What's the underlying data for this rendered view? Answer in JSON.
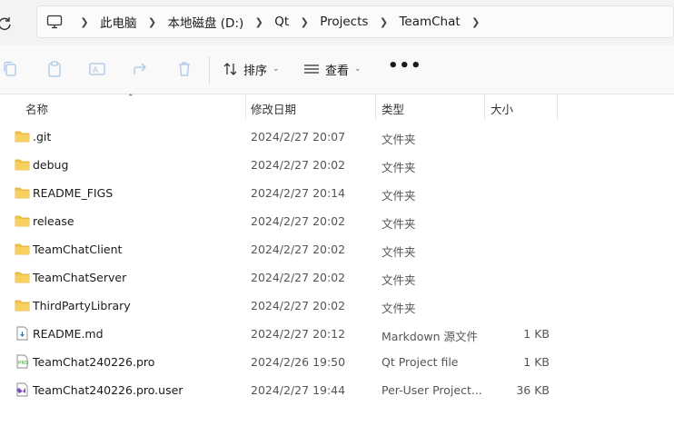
{
  "breadcrumb": [
    "此电脑",
    "本地磁盘 (D:)",
    "Qt",
    "Projects",
    "TeamChat"
  ],
  "toolbar": {
    "sort_label": "排序",
    "view_label": "查看",
    "more_label": "•••"
  },
  "columns": {
    "name": "名称",
    "date": "修改日期",
    "type": "类型",
    "size": "大小"
  },
  "files": [
    {
      "name": ".git",
      "date": "2024/2/27 20:07",
      "type": "文件夹",
      "size": "",
      "icon": "folder-icon"
    },
    {
      "name": "debug",
      "date": "2024/2/27 20:02",
      "type": "文件夹",
      "size": "",
      "icon": "folder-icon"
    },
    {
      "name": "README_FIGS",
      "date": "2024/2/27 20:14",
      "type": "文件夹",
      "size": "",
      "icon": "folder-icon"
    },
    {
      "name": "release",
      "date": "2024/2/27 20:02",
      "type": "文件夹",
      "size": "",
      "icon": "folder-icon"
    },
    {
      "name": "TeamChatClient",
      "date": "2024/2/27 20:02",
      "type": "文件夹",
      "size": "",
      "icon": "folder-icon"
    },
    {
      "name": "TeamChatServer",
      "date": "2024/2/27 20:02",
      "type": "文件夹",
      "size": "",
      "icon": "folder-icon"
    },
    {
      "name": "ThirdPartyLibrary",
      "date": "2024/2/27 20:02",
      "type": "文件夹",
      "size": "",
      "icon": "folder-icon"
    },
    {
      "name": "README.md",
      "date": "2024/2/27 20:12",
      "type": "Markdown 源文件",
      "size": "1 KB",
      "icon": "markdown-file-icon"
    },
    {
      "name": "TeamChat240226.pro",
      "date": "2024/2/26 19:50",
      "type": "Qt Project file",
      "size": "1 KB",
      "icon": "qt-pro-file-icon"
    },
    {
      "name": "TeamChat240226.pro.user",
      "date": "2024/2/27 19:44",
      "type": "Per-User Project...",
      "size": "36 KB",
      "icon": "visual-studio-file-icon"
    }
  ],
  "colors": {
    "folder": "#f4c542",
    "folder_dark": "#e0a82e",
    "accent": "#0067c0",
    "vs_purple": "#7a4fc4"
  }
}
